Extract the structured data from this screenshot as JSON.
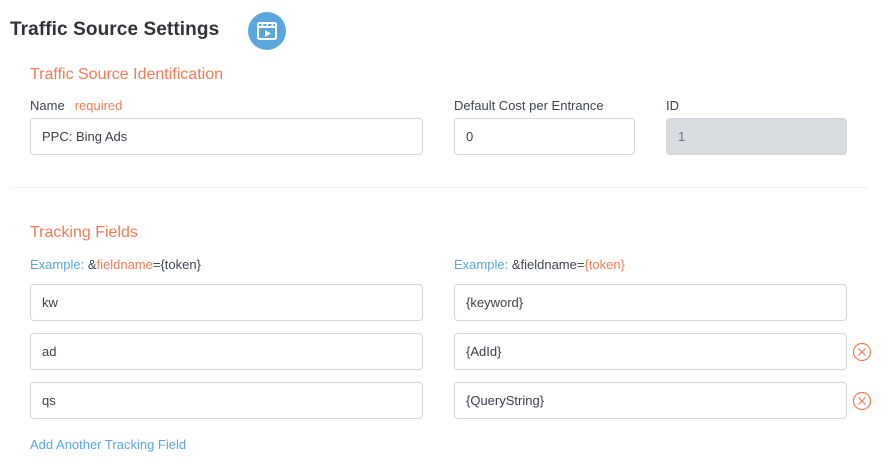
{
  "page": {
    "title": "Traffic Source Settings"
  },
  "identification": {
    "section_title": "Traffic Source Identification",
    "name_label": "Name",
    "required_label": "required",
    "name_value": "PPC: Bing Ads",
    "cost_label": "Default Cost per Entrance",
    "cost_value": "0",
    "id_label": "ID",
    "id_value": "1"
  },
  "tracking": {
    "section_title": "Tracking Fields",
    "example_left": {
      "prefix": "Example:",
      "amp": " &",
      "fieldname": "fieldname",
      "eq": "=",
      "token": "{token}"
    },
    "example_right": {
      "prefix": "Example:",
      "amp": " &",
      "fieldname": "fieldname",
      "eq": "=",
      "token": "{token}"
    },
    "rows": [
      {
        "name": "kw",
        "token": "{keyword}"
      },
      {
        "name": "ad",
        "token": "{AdId}"
      },
      {
        "name": "qs",
        "token": "{QueryString}"
      }
    ],
    "add_label": "Add Another Tracking Field"
  },
  "colors": {
    "accent_orange": "#ef7c57",
    "accent_blue": "#5aa7de",
    "disabled_bg": "#d9dde1"
  },
  "icons": {
    "video": "video-play-icon",
    "remove": "remove-circle-icon"
  }
}
